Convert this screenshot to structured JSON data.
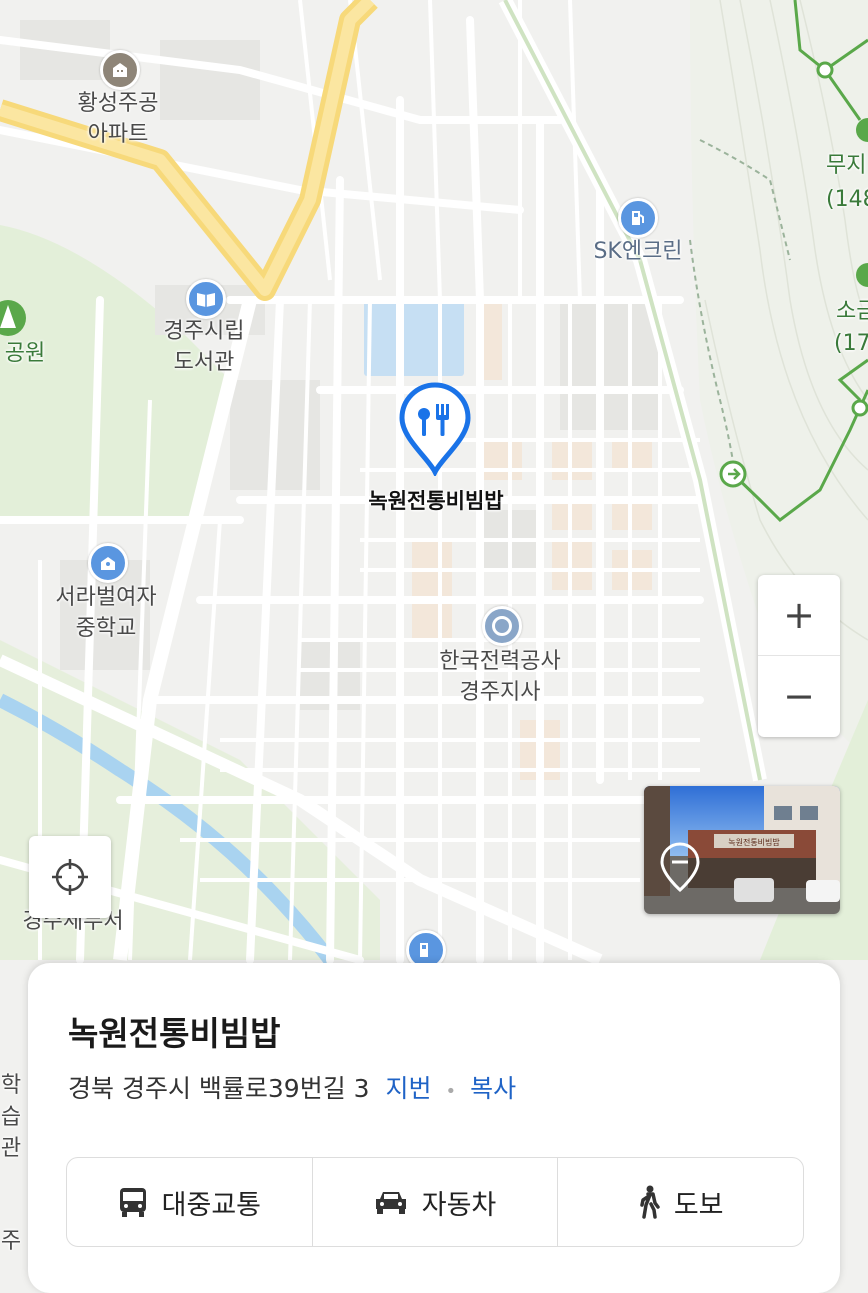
{
  "map": {
    "selected_place_label": "녹원전통비빔밥",
    "labels": {
      "apartment": "황성주공\n아파트",
      "library": "경주시립\n도서관",
      "park": "공원",
      "gas_station": "SK엔크린",
      "school": "서라벌여자\n중학교",
      "kepco": "한국전력공사\n경주지사",
      "tax_office": "경주세무서",
      "mountain1_name": "무지",
      "mountain1_height": "(148",
      "mountain2_name": "소금",
      "mountain2_height": "(17",
      "left_edge1": "학",
      "left_edge2": "습관",
      "left_edge3": "주"
    }
  },
  "controls": {
    "zoom_in": "+",
    "zoom_out": "−"
  },
  "panorama": {
    "storefront_sign": "녹원전통비빔밥"
  },
  "place": {
    "name": "녹원전통비빔밥",
    "address": "경북 경주시 백률로39번길 3",
    "jibun_label": "지번",
    "separator": "•",
    "copy_label": "복사"
  },
  "directions": {
    "transit_label": "대중교통",
    "car_label": "자동차",
    "walk_label": "도보"
  },
  "colors": {
    "accent_blue": "#1f63c6",
    "marker_blue": "#1a73e8",
    "park_green": "#e3efd9",
    "main_road_yellow": "#f7d97a",
    "water_blue": "#a9d3f0",
    "trail_green": "#5aa84a"
  }
}
